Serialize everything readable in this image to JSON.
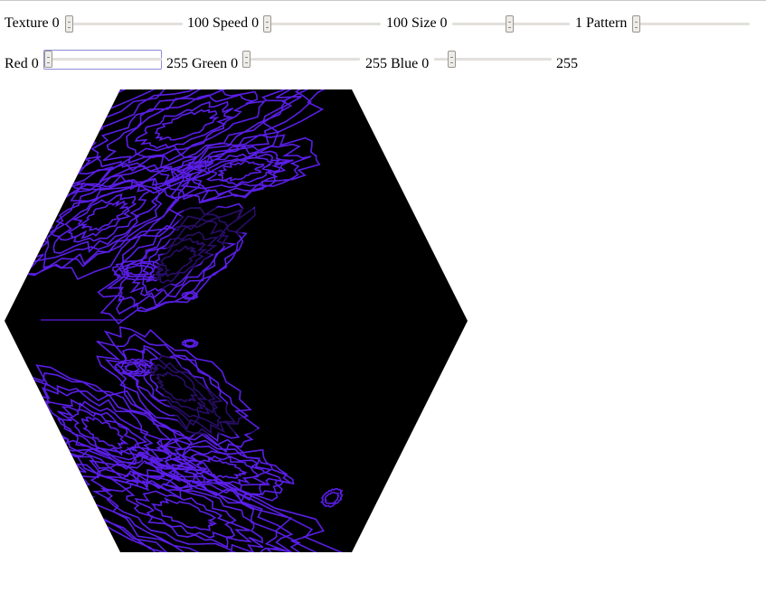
{
  "controls": {
    "row1": [
      {
        "label": "Texture",
        "min": "0",
        "max": "100",
        "value": 0
      },
      {
        "label": "Speed",
        "min": "0",
        "max": "100",
        "value": 0
      },
      {
        "label": "Size",
        "min": "0",
        "max": "1",
        "value": 0.5
      },
      {
        "label": "Pattern",
        "min": "",
        "max": "",
        "value": 0
      }
    ],
    "row2": [
      {
        "label": "Red",
        "min": "0",
        "max": "255",
        "value": 0
      },
      {
        "label": "Green",
        "min": "0",
        "max": "255",
        "value": 0
      },
      {
        "label": "Blue",
        "min": "0",
        "max": "255",
        "value": 0.15
      }
    ]
  },
  "hexagon": {
    "fill": "#000000",
    "pattern_color": "#5a1ee6"
  }
}
